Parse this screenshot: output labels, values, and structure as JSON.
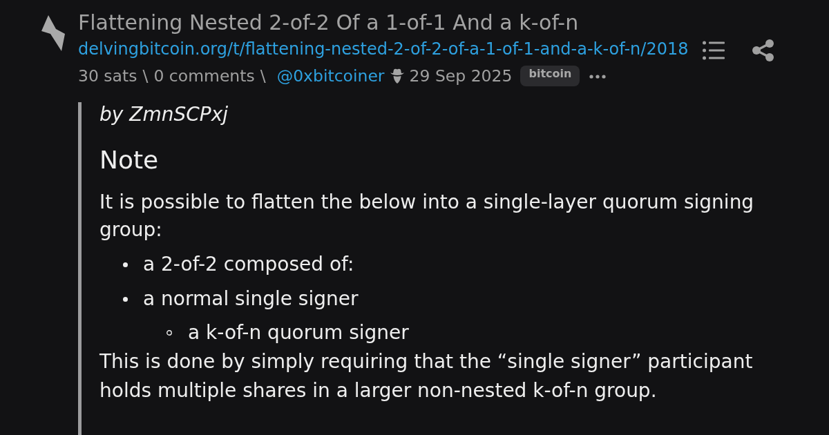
{
  "post": {
    "title": "Flattening Nested 2-of-2 Of a 1-of-1 And a k-of-n",
    "url": "delvingbitcoin.org/t/flattening-nested-2-of-2-of-a-1-of-1-and-a-k-of-n/2018",
    "meta": [
      {
        "kind": "stat",
        "text": "30 sats"
      },
      {
        "kind": "separator",
        "text": "\\"
      },
      {
        "kind": "stat",
        "text": "0 comments"
      },
      {
        "kind": "separator",
        "text": "\\"
      },
      {
        "kind": "author",
        "text": "@0xbitcoiner"
      },
      {
        "kind": "date",
        "text": "29 Sep 2025"
      },
      {
        "kind": "tag",
        "text": "bitcoin"
      }
    ],
    "body": [
      {
        "kind": "byline",
        "text": "by ZmnSCPxj"
      },
      {
        "kind": "heading",
        "text": "Note"
      },
      {
        "kind": "paragraph",
        "text": "It is possible to flatten the below into a single-layer quorum signing group:"
      },
      {
        "kind": "list",
        "items": [
          {
            "text": "a 2-of-2 composed of:"
          },
          {
            "text": "a normal single signer",
            "children": [
              {
                "text": "a k-of-n quorum signer"
              }
            ]
          }
        ]
      },
      {
        "kind": "paragraph",
        "text": "This is done by simply requiring that the “single signer” participant holds multiple shares in a larger non-nested k-of-n group."
      }
    ]
  }
}
